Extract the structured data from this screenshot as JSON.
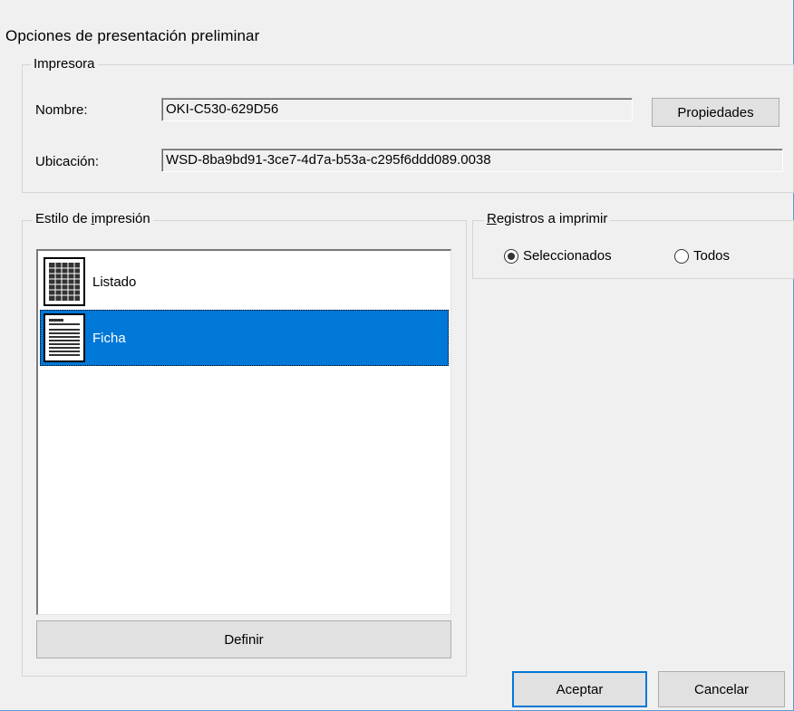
{
  "window": {
    "title": "Opciones de presentación preliminar"
  },
  "printer": {
    "group_label": "Impresora",
    "name_label": "Nombre:",
    "name_value": "OKI-C530-629D56",
    "properties_button": "Propiedades",
    "location_label": "Ubicación:",
    "location_value": "WSD-8ba9bd91-3ce7-4d7a-b53a-c295f6ddd089.0038"
  },
  "print_style": {
    "group_label_pre": "Estilo de ",
    "group_label_acc": "i",
    "group_label_post": "mpresión",
    "items": [
      {
        "label": "Listado",
        "icon": "table-grid-icon",
        "selected": false
      },
      {
        "label": "Ficha",
        "icon": "document-lines-icon",
        "selected": true
      }
    ],
    "define_button": "Definir"
  },
  "records": {
    "group_label_acc": "R",
    "group_label_post": "egistros a imprimir",
    "options": [
      {
        "label": "Seleccionados",
        "checked": true
      },
      {
        "label": "Todos",
        "checked": false
      }
    ]
  },
  "footer": {
    "accept_button": "Aceptar",
    "cancel_button": "Cancelar"
  },
  "colors": {
    "selection": "#0078d7",
    "window_bg": "#f0f0f0",
    "window_border": "#5b9bd5"
  }
}
